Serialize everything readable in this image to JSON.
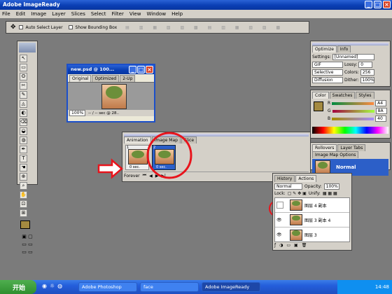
{
  "app": {
    "title": "Adobe ImageReady",
    "win_buttons": [
      "_",
      "□",
      "×"
    ]
  },
  "menu": [
    "File",
    "Edit",
    "Image",
    "Layer",
    "Slices",
    "Select",
    "Filter",
    "View",
    "Window",
    "Help"
  ],
  "options_bar": {
    "auto_select": "Auto Select Layer",
    "bounding_box": "Show Bounding Box"
  },
  "tools": [
    "↖",
    "▭",
    "ʘ",
    "✂",
    "✎",
    "◬",
    "◐",
    "⌫",
    "◒",
    "◍",
    "✒",
    "T",
    "☚",
    "⊕",
    "⌕",
    "✋",
    "⊡",
    "⊞"
  ],
  "doc": {
    "title": "new.psd @ 100...",
    "tabs": [
      "Original",
      "Optimized",
      "2-Up"
    ],
    "status": "100%",
    "status2": "-- / -- sec @ 28.."
  },
  "optimize": {
    "tabs": [
      "Optimize",
      "Info"
    ],
    "settings_label": "Settings:",
    "settings": "[Unnamed]",
    "format": "GIF",
    "lossy_label": "Lossy:",
    "lossy": "0",
    "reduction": "Selective",
    "colors_label": "Colors:",
    "colors": "256",
    "dither_algo": "Diffusion",
    "dither_label": "Dither:",
    "dither": "100%"
  },
  "color": {
    "tabs": [
      "Color",
      "Swatches",
      "Styles"
    ],
    "r": "R",
    "g": "G",
    "b": "B",
    "r_val": "A4",
    "g_val": "8A",
    "b_val": "40",
    "fg_color": "#a48a40"
  },
  "rollovers": {
    "tabs": [
      "Rollovers",
      "Layer Tabs",
      "Image Map Options"
    ],
    "state": "Normal"
  },
  "animation": {
    "tabs": [
      "Animation",
      "Image Map",
      "Slice"
    ],
    "frame1": "1",
    "frame2": "2",
    "delay1": "0 sec.",
    "delay2": "0 sec.",
    "loop": "Forever"
  },
  "layers": {
    "tabs": [
      "History",
      "Actions"
    ],
    "blend": "Normal",
    "opacity_label": "Opacity:",
    "opacity": "100%",
    "lock_label": "Lock:",
    "unify_label": "Unify:",
    "items": [
      {
        "name": "图层 4 副本"
      },
      {
        "name": "图层 3 副本 4"
      },
      {
        "name": "图层 3"
      }
    ]
  },
  "taskbar": {
    "start": "开始",
    "items": [
      "Adobe Photoshop",
      "face",
      "Adobe ImageReady"
    ],
    "time": "14:48"
  },
  "highlight_color": "#e8141c"
}
